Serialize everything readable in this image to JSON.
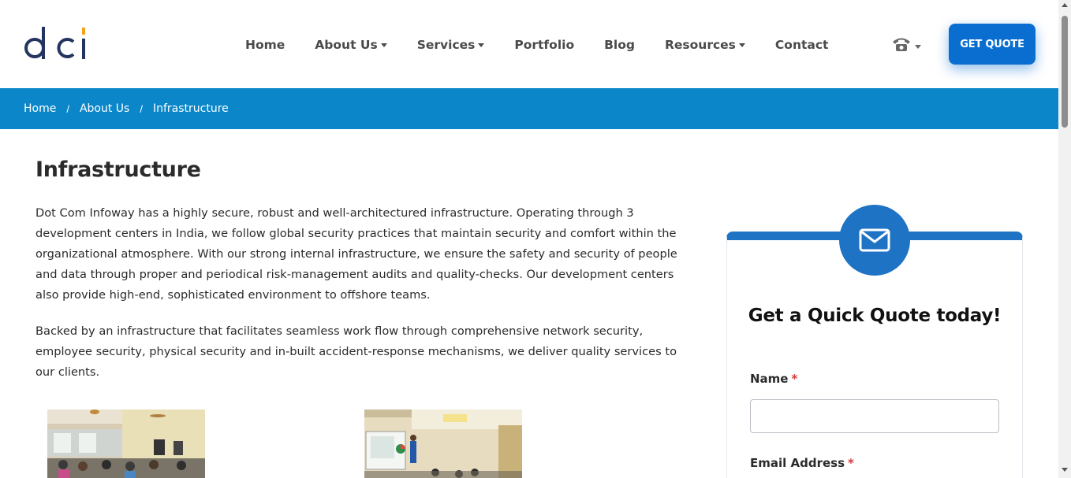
{
  "header": {
    "logo_text": "dci",
    "nav": [
      {
        "label": "Home",
        "dropdown": false
      },
      {
        "label": "About Us",
        "dropdown": true
      },
      {
        "label": "Services",
        "dropdown": true
      },
      {
        "label": "Portfolio",
        "dropdown": false
      },
      {
        "label": "Blog",
        "dropdown": false
      },
      {
        "label": "Resources",
        "dropdown": true
      },
      {
        "label": "Contact",
        "dropdown": false
      }
    ],
    "phone_icon": "phone-icon",
    "quote_button": "GET QUOTE"
  },
  "breadcrumb": {
    "items": [
      "Home",
      "About Us",
      "Infrastructure"
    ],
    "separator": "/"
  },
  "main": {
    "title": "Infrastructure",
    "paragraph1": "Dot Com Infoway has a highly secure, robust and well-architectured infrastructure. Operating through 3 development centers in India, we follow global security practices that maintain security and comfort within the organizational atmosphere. With our strong internal infrastructure, we ensure the safety and security of people and data through proper and periodical risk-management audits and quality-checks. Our development centers also provide high-end, sophisticated environment to offshore teams.",
    "paragraph2": "Backed by an infrastructure that facilitates seamless work flow through comprehensive network security, employee security, physical security and in-built accident-response mechanisms, we deliver quality services to our clients."
  },
  "quote_form": {
    "icon": "envelope-icon",
    "title": "Get a Quick Quote today!",
    "name_label": "Name",
    "email_label": "Email Address",
    "required_mark": "*",
    "name_value": ""
  },
  "colors": {
    "brand_blue": "#0a6ed1",
    "breadcrumb_bg": "#0a86c9",
    "card_accent": "#1f73c4",
    "logo_navy": "#23355f",
    "logo_accent": "#f4a21a",
    "required": "#d23a3a"
  }
}
